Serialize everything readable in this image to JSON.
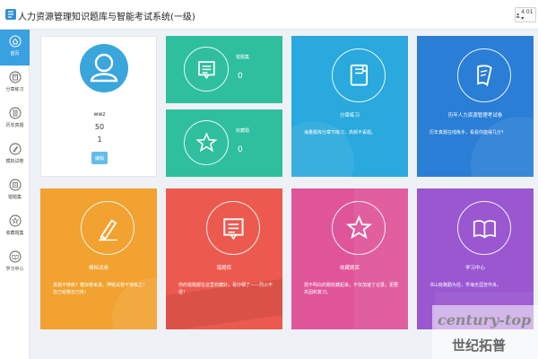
{
  "header": {
    "title": "人力资源管理知识题库与智能考试系统(一级)",
    "user_label": "4 01 ▾"
  },
  "sidebar": {
    "items": [
      {
        "label": "首页",
        "icon": "home-icon"
      },
      {
        "label": "分章练习",
        "icon": "book-icon"
      },
      {
        "label": "历年真题",
        "icon": "document-icon"
      },
      {
        "label": "模拟试卷",
        "icon": "exam-icon"
      },
      {
        "label": "错题集",
        "icon": "list-icon"
      },
      {
        "label": "收藏题集",
        "icon": "star-icon"
      },
      {
        "label": "学习中心",
        "icon": "study-icon"
      }
    ]
  },
  "profile": {
    "name": "wwz",
    "value_1": "50",
    "value_2": "1",
    "edit_label": "编辑"
  },
  "stats": [
    {
      "label": "错题集",
      "value": "0",
      "color": "#2fbf9e"
    },
    {
      "label": "收藏题",
      "value": "0",
      "color": "#2fbf9e"
    }
  ],
  "tiles": [
    {
      "title": "分章练习",
      "desc": "海量题库分章节练习，高频不丢题。",
      "color": "#29a9dd",
      "icon": "book-icon"
    },
    {
      "title": "历年人力资源管理考试卷",
      "desc": "历年真题在线练手，看看你能得几分？",
      "color": "#2a7ed6",
      "icon": "scroll-icon"
    },
    {
      "title": "模拟试卷",
      "desc": "真题不够练？模拟卷来凑，押题试卷不够练之！自己组卷自己练！",
      "color": "#f1a230",
      "icon": "pen-icon"
    },
    {
      "title": "错题库",
      "desc": "你的错题都在这里收藏好，看仔细了——烈火不侵！",
      "color": "#ec5a4f",
      "icon": "list-icon"
    },
    {
      "title": "收藏题库",
      "desc": "把不明白的题收藏起来，不仅加速了记录，更要巩固和复习。",
      "color": "#e0559a",
      "icon": "star-icon"
    },
    {
      "title": "学习中心",
      "desc": "书山有路勤为径，学海无涯苦作舟。",
      "color": "#9a57d0",
      "icon": "open-book-icon"
    }
  ],
  "watermark": {
    "text_en": "century-top",
    "text_cn": "世纪拓普"
  },
  "colors": {
    "accent": "#3aa1e0",
    "background": "#eef1f5"
  }
}
